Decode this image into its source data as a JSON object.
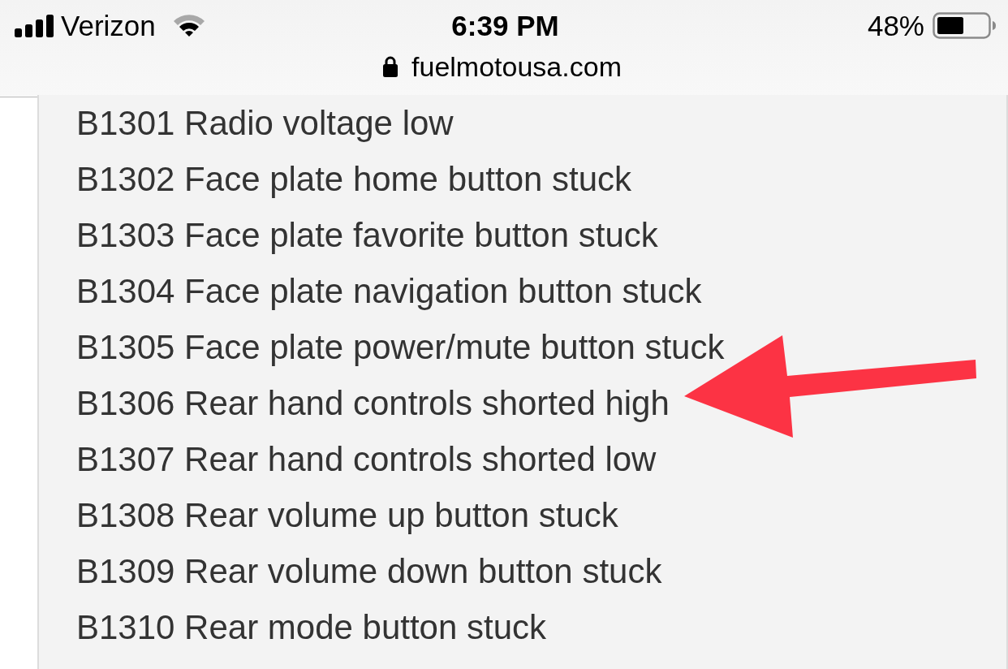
{
  "status_bar": {
    "carrier": "Verizon",
    "time": "6:39 PM",
    "battery": "48%"
  },
  "address_bar": {
    "secure": true,
    "url": "fuelmotousa.com"
  },
  "codes": [
    {
      "text": "B1301 Radio voltage low",
      "marked": false
    },
    {
      "text": "B1302 Face plate home button stuck",
      "marked": false
    },
    {
      "text": "B1303 Face plate favorite button stuck",
      "marked": false
    },
    {
      "text": "B1304 Face plate navigation button stuck",
      "marked": false
    },
    {
      "text": "B1305 Face plate power/mute button stuck",
      "marked": false
    },
    {
      "text": "B1306 Rear hand controls shorted high",
      "marked": true
    },
    {
      "text": "B1307 Rear hand controls shorted low",
      "marked": false
    },
    {
      "text": "B1308 Rear volume up button stuck",
      "marked": false
    },
    {
      "text": "B1309 Rear volume down button stuck",
      "marked": false
    },
    {
      "text": "B1310 Rear mode button stuck",
      "marked": false
    }
  ]
}
